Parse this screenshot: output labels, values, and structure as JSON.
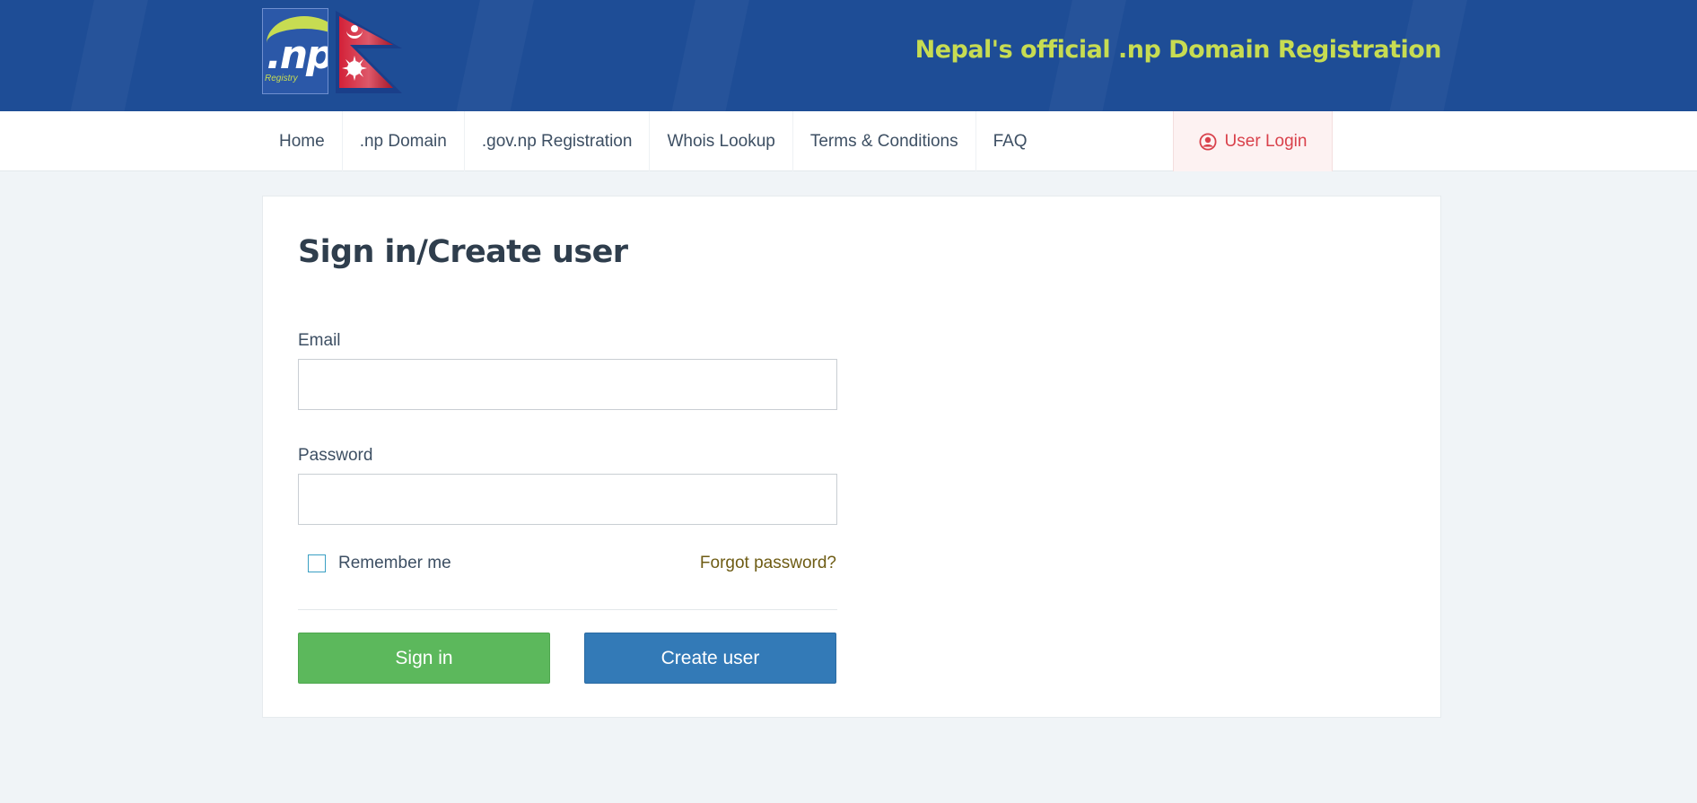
{
  "header": {
    "logo": {
      "text": ".np",
      "subtext": "Registry"
    },
    "tagline": "Nepal's official .np Domain Registration",
    "colors": {
      "background": "#1e4d96",
      "accent": "#c7dc52"
    }
  },
  "nav": {
    "items": [
      {
        "label": "Home"
      },
      {
        "label": ".np Domain"
      },
      {
        "label": ".gov.np Registration"
      },
      {
        "label": "Whois Lookup"
      },
      {
        "label": "Terms & Conditions"
      },
      {
        "label": "FAQ"
      }
    ],
    "login": {
      "label": "User Login",
      "icon": "user-circle-icon",
      "color": "#d9414b"
    }
  },
  "form": {
    "title": "Sign in/Create user",
    "email": {
      "label": "Email",
      "value": ""
    },
    "password": {
      "label": "Password",
      "value": ""
    },
    "remember": {
      "label": "Remember me",
      "checked": false
    },
    "forgot_label": "Forgot password?",
    "signin_label": "Sign in",
    "create_label": "Create user",
    "colors": {
      "signin": "#5cb85c",
      "create": "#337ab7"
    }
  }
}
